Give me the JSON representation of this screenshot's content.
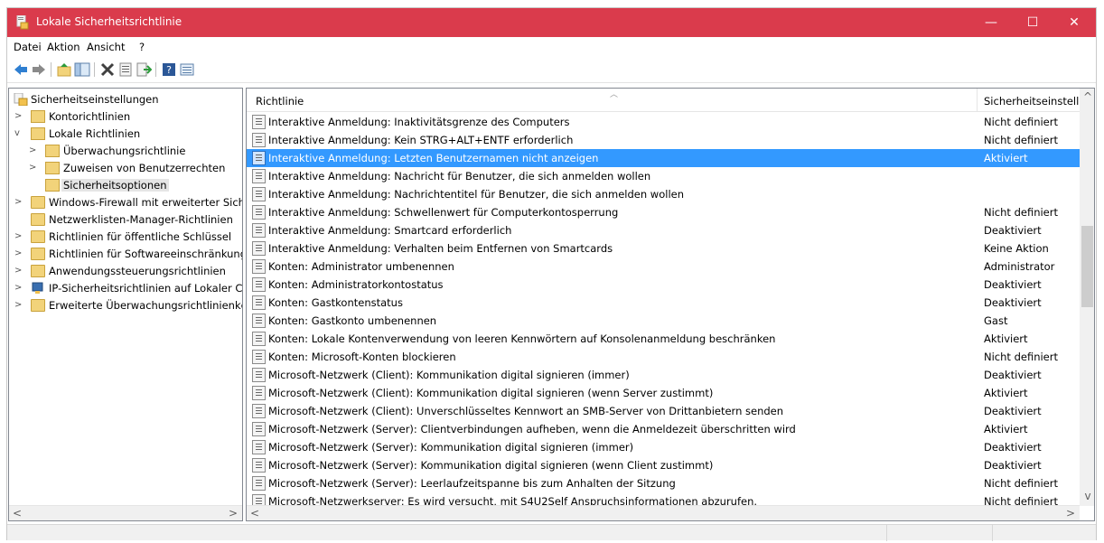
{
  "window": {
    "title": "Lokale Sicherheitsrichtlinie",
    "accent_color": "#da3b4c",
    "minimize_glyph": "—",
    "maximize_glyph": "☐",
    "close_glyph": "✕"
  },
  "menu": {
    "items": [
      "Datei",
      "Aktion",
      "Ansicht",
      "?"
    ]
  },
  "toolbar": {
    "icons": [
      "back-icon",
      "forward-icon",
      "up-folder-icon",
      "show-hide-tree-icon",
      "delete-icon",
      "properties-icon",
      "export-list-icon",
      "help-icon",
      "details-view-icon"
    ]
  },
  "tree": {
    "items": [
      {
        "label": "Sicherheitseinstellungen",
        "expander": ""
      },
      {
        "label": "Kontorichtlinien",
        "expander": ">"
      },
      {
        "label": "Lokale Richtlinien",
        "expander": "v"
      },
      {
        "label": "Überwachungsrichtlinie",
        "expander": ">"
      },
      {
        "label": "Zuweisen von Benutzerrechten",
        "expander": ">"
      },
      {
        "label": "Sicherheitsoptionen",
        "expander": ""
      },
      {
        "label": "Windows-Firewall mit erweiterter Sich",
        "expander": ">"
      },
      {
        "label": "Netzwerklisten-Manager-Richtlinien",
        "expander": ""
      },
      {
        "label": "Richtlinien für öffentliche Schlüssel",
        "expander": ">"
      },
      {
        "label": "Richtlinien für Softwareeinschränkung",
        "expander": ">"
      },
      {
        "label": "Anwendungssteuerungsrichtlinien",
        "expander": ">"
      },
      {
        "label": "IP-Sicherheitsrichtlinien auf Lokaler C",
        "expander": ">"
      },
      {
        "label": "Erweiterte Überwachungsrichtlinienkc",
        "expander": ">"
      }
    ],
    "selected_index": 5
  },
  "list": {
    "columns": [
      "Richtlinie",
      "Sicherheitseinstellu"
    ],
    "selected_index": 2,
    "rows": [
      {
        "name": "Interaktive Anmeldung: Inaktivitätsgrenze des Computers",
        "value": "Nicht definiert"
      },
      {
        "name": "Interaktive Anmeldung: Kein STRG+ALT+ENTF erforderlich",
        "value": "Nicht definiert"
      },
      {
        "name": "Interaktive Anmeldung: Letzten Benutzernamen nicht anzeigen",
        "value": "Aktiviert"
      },
      {
        "name": "Interaktive Anmeldung: Nachricht für Benutzer, die sich anmelden wollen",
        "value": ""
      },
      {
        "name": "Interaktive Anmeldung: Nachrichtentitel für Benutzer, die sich anmelden wollen",
        "value": ""
      },
      {
        "name": "Interaktive Anmeldung: Schwellenwert für Computerkontosperrung",
        "value": "Nicht definiert"
      },
      {
        "name": "Interaktive Anmeldung: Smartcard erforderlich",
        "value": "Deaktiviert"
      },
      {
        "name": "Interaktive Anmeldung: Verhalten beim Entfernen von Smartcards",
        "value": "Keine Aktion"
      },
      {
        "name": "Konten: Administrator umbenennen",
        "value": "Administrator"
      },
      {
        "name": "Konten: Administratorkontostatus",
        "value": "Deaktiviert"
      },
      {
        "name": "Konten: Gastkontenstatus",
        "value": "Deaktiviert"
      },
      {
        "name": "Konten: Gastkonto umbenennen",
        "value": "Gast"
      },
      {
        "name": "Konten: Lokale Kontenverwendung von leeren Kennwörtern auf Konsolenanmeldung beschränken",
        "value": "Aktiviert"
      },
      {
        "name": "Konten: Microsoft-Konten blockieren",
        "value": "Nicht definiert"
      },
      {
        "name": "Microsoft-Netzwerk (Client): Kommunikation digital signieren (immer)",
        "value": "Deaktiviert"
      },
      {
        "name": "Microsoft-Netzwerk (Client): Kommunikation digital signieren (wenn Server zustimmt)",
        "value": "Aktiviert"
      },
      {
        "name": "Microsoft-Netzwerk (Client): Unverschlüsseltes Kennwort an SMB-Server von Drittanbietern senden",
        "value": "Deaktiviert"
      },
      {
        "name": "Microsoft-Netzwerk (Server): Clientverbindungen aufheben, wenn die Anmeldezeit überschritten wird",
        "value": "Aktiviert"
      },
      {
        "name": "Microsoft-Netzwerk (Server): Kommunikation digital signieren (immer)",
        "value": "Deaktiviert"
      },
      {
        "name": "Microsoft-Netzwerk (Server): Kommunikation digital signieren (wenn Client zustimmt)",
        "value": "Deaktiviert"
      },
      {
        "name": "Microsoft-Netzwerk (Server): Leerlaufzeitspanne bis zum Anhalten der Sitzung",
        "value": "Nicht definiert"
      },
      {
        "name": "Microsoft-Netzwerkserver: Es wird versucht, mit S4U2Self Anspruchsinformationen abzurufen.",
        "value": "Nicht definiert"
      }
    ]
  },
  "scroll": {
    "left_arrow": "<",
    "right_arrow": ">",
    "up_arrow": "^",
    "down_arrow": "v"
  }
}
